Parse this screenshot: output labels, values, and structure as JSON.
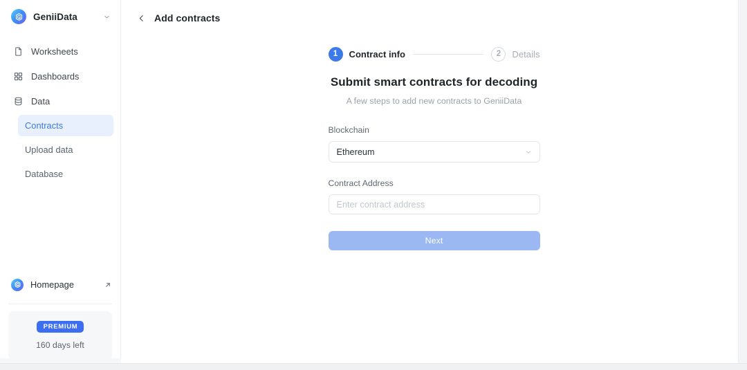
{
  "sidebar": {
    "brand": {
      "name": "GeniiData",
      "logo_icon": "geniidata-logo-icon",
      "caret_icon": "chevron-down-icon"
    },
    "nav": [
      {
        "label": "Worksheets",
        "icon": "document-icon",
        "key": "worksheets"
      },
      {
        "label": "Dashboards",
        "icon": "grid-icon",
        "key": "dashboards"
      },
      {
        "label": "Data",
        "icon": "database-icon",
        "key": "data"
      }
    ],
    "sub_nav": [
      {
        "label": "Contracts",
        "key": "contracts",
        "active": true
      },
      {
        "label": "Upload data",
        "key": "upload-data",
        "active": false
      },
      {
        "label": "Database",
        "key": "database",
        "active": false
      }
    ],
    "homepage": {
      "label": "Homepage",
      "logo_icon": "geniidata-logo-icon",
      "external_icon": "external-link-icon"
    },
    "premium": {
      "badge": "PREMIUM",
      "days_left": "160 days left"
    }
  },
  "topbar": {
    "back_icon": "chevron-left-icon",
    "title": "Add contracts"
  },
  "stepper": {
    "steps": [
      {
        "number": "1",
        "label": "Contract info",
        "state": "active"
      },
      {
        "number": "2",
        "label": "Details",
        "state": "inactive"
      }
    ]
  },
  "page": {
    "title": "Submit smart contracts for decoding",
    "subtitle": "A few steps to add new contracts to GeniiData"
  },
  "form": {
    "blockchain": {
      "label": "Blockchain",
      "value": "Ethereum",
      "caret_icon": "chevron-down-icon"
    },
    "contract_address": {
      "label": "Contract Address",
      "value": "",
      "placeholder": "Enter contract address"
    },
    "submit": {
      "label": "Next"
    }
  },
  "colors": {
    "accent_blue": "#3b7ae8",
    "premium_blue": "#3b6ef0",
    "active_nav_bg": "#e8f0fe",
    "button_disabled": "#9cb8f2"
  }
}
